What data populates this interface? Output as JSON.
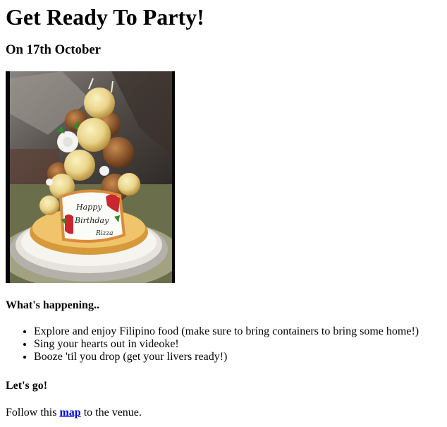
{
  "page": {
    "title": "Get Ready To Party!",
    "date": "On 17th October",
    "photo": {
      "cake_text_line1": "Happy",
      "cake_text_line2": "Birthday",
      "cake_text_line3": "Rizza"
    },
    "happening_heading": "What's happening..",
    "activities": [
      "Explore and enjoy Filipino food (make sure to bring containers to bring some home!)",
      "Sing your hearts out in videoke!",
      "Booze 'til you drop (get your livers ready!)"
    ],
    "lets_go_heading": "Let's go!",
    "directions": {
      "before": "Follow this ",
      "link_text": "map",
      "after": " to the venue."
    }
  }
}
